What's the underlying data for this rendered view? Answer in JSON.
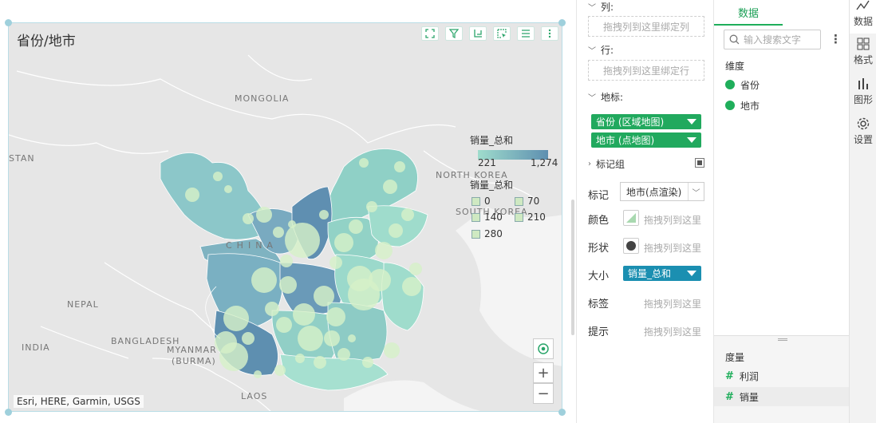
{
  "canvas": {
    "title": "省份/地市",
    "toolbar_icons": [
      "fullscreen-icon",
      "filter-icon",
      "drill-icon",
      "select-icon",
      "list-icon",
      "more-icon"
    ],
    "map_labels": {
      "mongolia": "MONGOLIA",
      "north_korea": "NORTH KOREA",
      "south_korea": "SOUTH KOREA",
      "china": "CHINA",
      "nepal": "NEPAL",
      "india": "INDIA",
      "bangladesh": "BANGLADESH",
      "myanmar": "MYANMAR",
      "burma": "(BURMA)",
      "laos": "LAOS",
      "stan": "STAN"
    },
    "attribution": "Esri, HERE, Garmin, USGS",
    "zoom_in": "+",
    "zoom_out": "−",
    "legend": {
      "color_title": "销量_总和",
      "color_min": "221",
      "color_max": "1,274",
      "size_title": "销量_总和",
      "size_items": [
        "0",
        "70",
        "140",
        "210",
        "280"
      ]
    },
    "colors": {
      "region_light": "#9fdccc",
      "region_dark": "#5e8fb0",
      "bubble": "#d6f0c8"
    }
  },
  "binding": {
    "columns": {
      "title": "列:",
      "placeholder": "拖拽列到这里绑定列"
    },
    "rows": {
      "title": "行:",
      "placeholder": "拖拽列到这里绑定行"
    },
    "geo": {
      "title": "地标:",
      "pills": [
        "省份 (区域地图)",
        "地市 (点地图)"
      ]
    },
    "mark_group": "标记组",
    "mark": {
      "label": "标记",
      "value": "地市(点渲染)"
    },
    "color": {
      "label": "颜色",
      "hint": "拖拽列到这里"
    },
    "shape": {
      "label": "形状",
      "hint": "拖拽列到这里"
    },
    "size": {
      "label": "大小",
      "pill": "销量_总和"
    },
    "label": {
      "label": "标签",
      "hint": "拖拽列到这里"
    },
    "tooltip": {
      "label": "提示",
      "hint": "拖拽列到这里"
    }
  },
  "data_panel": {
    "tab": "数据",
    "search_placeholder": "输入搜索文字",
    "dimensions_title": "维度",
    "dimensions": [
      "省份",
      "地市"
    ],
    "measures_title": "度量",
    "measures": [
      "利润",
      "销量"
    ],
    "accent": "#1fae5b"
  },
  "side_tabs": [
    {
      "label": "数据",
      "icon": "data-icon"
    },
    {
      "label": "格式",
      "icon": "format-icon"
    },
    {
      "label": "图形",
      "icon": "chart-icon"
    },
    {
      "label": "设置",
      "icon": "gear-icon"
    }
  ]
}
